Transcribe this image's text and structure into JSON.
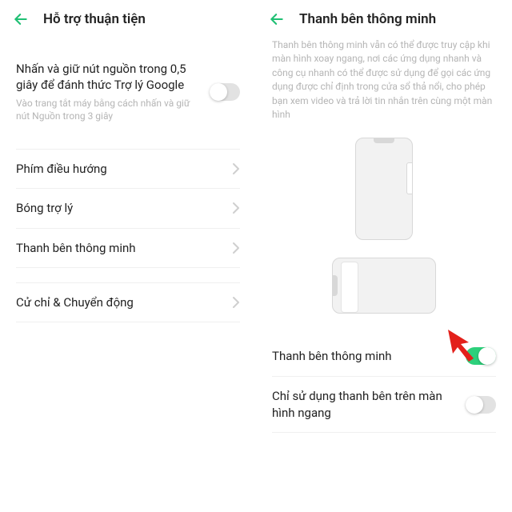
{
  "left": {
    "header_title": "Hỗ trợ thuận tiện",
    "google_assist": {
      "title": "Nhấn và giữ nút nguồn trong 0,5 giây để đánh thức Trợ lý Google",
      "sub": "Vào trang tắt máy bằng cách nhấn và giữ nút Nguồn trong 3 giây"
    },
    "nav_keys": "Phím điều hướng",
    "assistant_ball": "Bóng trợ lý",
    "smart_sidebar": "Thanh bên thông minh",
    "gesture_motion": "Cử chỉ & Chuyển động"
  },
  "right": {
    "header_title": "Thanh bên thông minh",
    "description": "Thanh bên thông minh vẫn có thể được truy cập khi màn hình xoay ngang, nơi các ứng dụng nhanh và công cụ nhanh có thể được sử dụng để gọi các ứng dụng được chỉ định trong cửa sổ thả nổi, cho phép bạn xem video và trả lời tin nhắn trên cùng một màn hình",
    "smart_sidebar_toggle": "Thanh bên thông minh",
    "landscape_only": "Chỉ sử dụng thanh bên trên màn hình ngang"
  }
}
